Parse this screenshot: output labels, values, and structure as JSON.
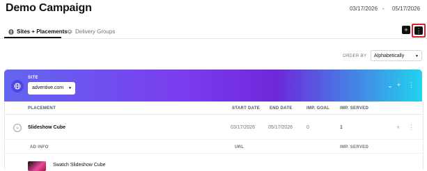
{
  "page": {
    "title": "Demo Campaign",
    "start_date": "03/17/2026",
    "date_sep": "-",
    "end_date": "05/17/2026"
  },
  "tabs": [
    {
      "label": "Sites + Placements",
      "icon": "globe-icon",
      "active": true
    },
    {
      "label": "Delivery Groups",
      "icon": "layers-icon",
      "active": false
    }
  ],
  "toolbar": {
    "add_label": "+",
    "menu_label": "⋮"
  },
  "order": {
    "label": "ORDER BY",
    "value": "Alphabetically"
  },
  "site": {
    "label": "SITE",
    "value": "adventive.com"
  },
  "placements": {
    "headers": {
      "placement": "PLACEMENT",
      "start": "START DATE",
      "end": "END DATE",
      "goal": "IMP. GOAL",
      "served": "IMP. SERVED"
    },
    "row": {
      "name": "Slideshow Cube",
      "start": "03/17/2026",
      "end": "05/17/2026",
      "goal": "0",
      "served": "1"
    }
  },
  "ads": {
    "headers": {
      "info": "AD INFO",
      "url": "URL",
      "served": "IMP. SERVED"
    },
    "row": {
      "name": "Swatch Slideshow Cube"
    }
  },
  "colors": {
    "accent": "#111111",
    "highlight": "#e11d2b",
    "banner_start": "#6366f1",
    "banner_end": "#22d3ee"
  }
}
